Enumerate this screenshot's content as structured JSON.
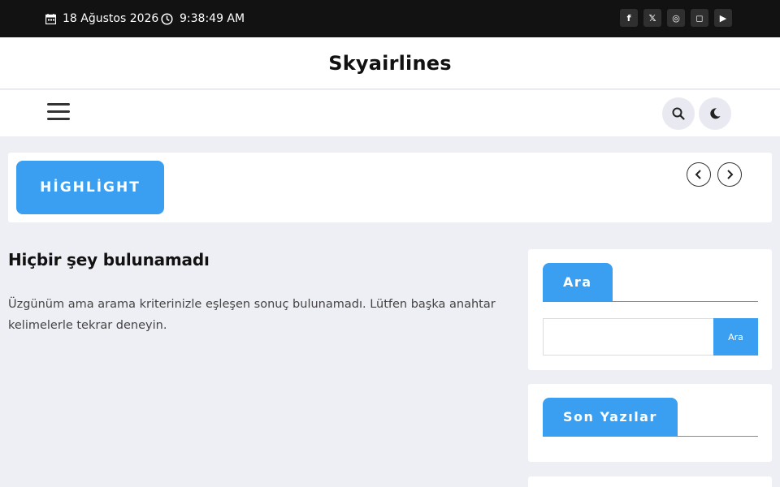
{
  "topbar": {
    "date": "18 Ağustos 2026",
    "time": "9:38:49 AM",
    "socials": [
      {
        "name": "facebook-icon",
        "glyph": "f"
      },
      {
        "name": "x-twitter-icon",
        "glyph": "𝕏"
      },
      {
        "name": "dribbble-icon",
        "glyph": "◎"
      },
      {
        "name": "instagram-icon",
        "glyph": "◻"
      },
      {
        "name": "youtube-icon",
        "glyph": "▶"
      }
    ]
  },
  "header": {
    "site_title": "Skyairlines"
  },
  "highlight": {
    "label": "HİGHLİGHT"
  },
  "main": {
    "title": "Hiçbir şey bulunamadı",
    "message": "Üzgünüm ama arama kriterinizle eşleşen sonuç bulunamadı. Lütfen başka anahtar kelimelerle tekrar deneyin."
  },
  "sidebar": {
    "search_widget": {
      "title": "Ara",
      "input_value": "",
      "button_label": "Ara"
    },
    "recent_widget": {
      "title": "Son Yazılar"
    }
  },
  "colors": {
    "accent": "#3a9ff0",
    "topbar": "#121212",
    "background": "#eeeef5"
  }
}
